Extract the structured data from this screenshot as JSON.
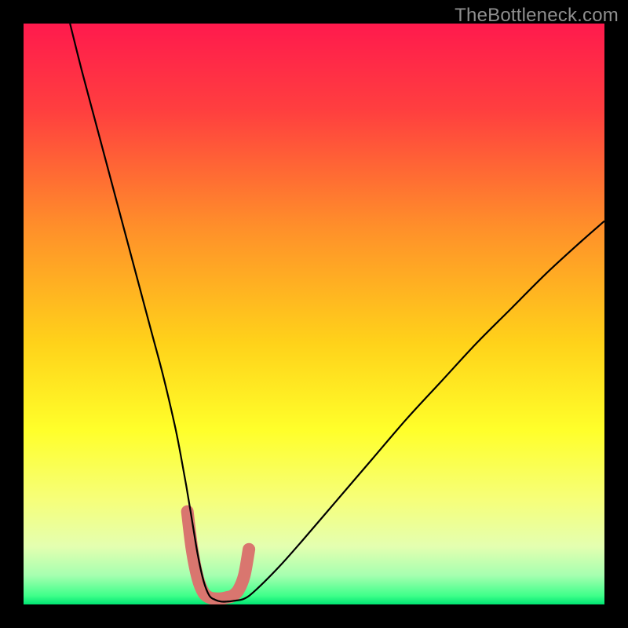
{
  "watermark": "TheBottleneck.com",
  "chart_data": {
    "type": "line",
    "title": "",
    "xlabel": "",
    "ylabel": "",
    "x_range": [
      0,
      100
    ],
    "y_range": [
      0,
      100
    ],
    "background_gradient": {
      "stops": [
        {
          "pos": 0.0,
          "color": "#ff1a4d"
        },
        {
          "pos": 0.15,
          "color": "#ff3f3f"
        },
        {
          "pos": 0.35,
          "color": "#ff8f2a"
        },
        {
          "pos": 0.55,
          "color": "#ffd21a"
        },
        {
          "pos": 0.7,
          "color": "#ffff2a"
        },
        {
          "pos": 0.82,
          "color": "#f6ff7a"
        },
        {
          "pos": 0.9,
          "color": "#e4ffb0"
        },
        {
          "pos": 0.95,
          "color": "#a6ffb0"
        },
        {
          "pos": 0.985,
          "color": "#3fff8a"
        },
        {
          "pos": 1.0,
          "color": "#00e572"
        }
      ]
    },
    "series": [
      {
        "name": "bottleneck-curve",
        "stroke": "#000000",
        "width": 2.2,
        "x": [
          8,
          10,
          12,
          14,
          16,
          18,
          20,
          22,
          24,
          26,
          27,
          28,
          29,
          30,
          31,
          32,
          33,
          34,
          35,
          36,
          38,
          40,
          44,
          48,
          54,
          60,
          66,
          72,
          78,
          84,
          90,
          96,
          100
        ],
        "y": [
          100,
          92,
          84.5,
          77,
          69.5,
          62,
          54.5,
          47,
          39.5,
          31,
          26,
          20.5,
          14.5,
          8.5,
          4,
          1.5,
          0.8,
          0.5,
          0.5,
          0.6,
          1,
          2.5,
          6.5,
          11,
          18,
          25,
          32,
          38.5,
          45,
          51,
          57,
          62.5,
          66
        ]
      },
      {
        "name": "highlight-band",
        "stroke": "#d9766f",
        "width": 16,
        "linecap": "round",
        "x": [
          28.2,
          29,
          30,
          31,
          32,
          33,
          34,
          35,
          36,
          37,
          38,
          38.8
        ],
        "y": [
          16,
          9.5,
          4.5,
          2,
          1.2,
          1,
          1,
          1.2,
          1.5,
          2.5,
          5,
          9.5
        ]
      }
    ]
  }
}
